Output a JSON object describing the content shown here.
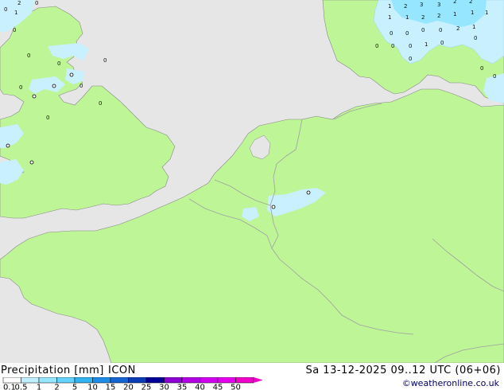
{
  "title": "Precipitation [mm]",
  "model": "ICON",
  "valid_time": "Sa 13-12-2025 09..12 UTC (06+06)",
  "credit": "©weatheronline.co.uk",
  "legend": {
    "labels": [
      "0.1",
      "0.5",
      "1",
      "2",
      "5",
      "10",
      "15",
      "20",
      "25",
      "30",
      "35",
      "40",
      "45",
      "50"
    ],
    "colors": [
      "#ffffff",
      "#c0f0ff",
      "#96e6ff",
      "#64d2fa",
      "#32b4f0",
      "#1e8ce6",
      "#1464d2",
      "#0a3cb4",
      "#000096",
      "#8c00d2",
      "#b400e6",
      "#d200f0",
      "#e600f0",
      "#f000c8"
    ]
  },
  "colors": {
    "sea": "#e6e6e6",
    "land": "#bef596",
    "border": "#a0a0a0",
    "coast": "#888888",
    "precip_light": "#c8f0ff",
    "precip_medium": "#96e6ff"
  },
  "precip_values": [
    {
      "v": "2"
    },
    {
      "v": "0"
    },
    {
      "v": "1"
    },
    {
      "v": "0"
    },
    {
      "v": "0"
    },
    {
      "v": "0"
    },
    {
      "v": "1"
    },
    {
      "v": "2"
    },
    {
      "v": "3"
    },
    {
      "v": "3"
    },
    {
      "v": "2"
    },
    {
      "v": "2"
    },
    {
      "v": "1"
    },
    {
      "v": "1"
    },
    {
      "v": "2"
    },
    {
      "v": "2"
    },
    {
      "v": "1"
    },
    {
      "v": "1"
    },
    {
      "v": "1"
    },
    {
      "v": "0"
    },
    {
      "v": "0"
    },
    {
      "v": "0"
    },
    {
      "v": "0"
    },
    {
      "v": "2"
    },
    {
      "v": "1"
    },
    {
      "v": "0"
    },
    {
      "v": "0"
    },
    {
      "v": "0"
    },
    {
      "v": "1"
    },
    {
      "v": "0"
    },
    {
      "v": "0"
    },
    {
      "v": "0"
    },
    {
      "v": "0"
    },
    {
      "v": "0"
    },
    {
      "v": "0"
    },
    {
      "v": "0"
    },
    {
      "v": "0"
    },
    {
      "v": "0"
    },
    {
      "v": "0"
    },
    {
      "v": "0"
    }
  ]
}
